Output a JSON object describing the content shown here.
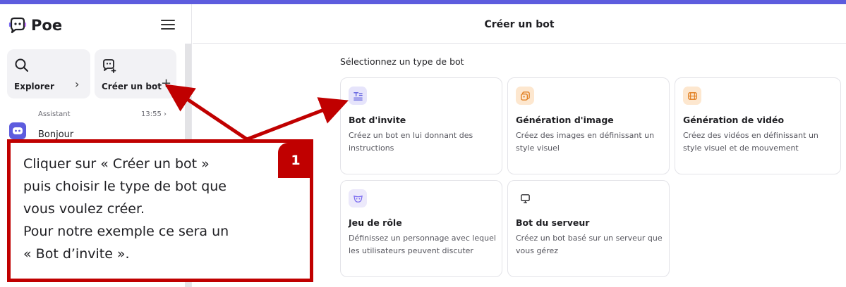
{
  "app": {
    "name": "Poe"
  },
  "sidebar": {
    "explore_label": "Explorer",
    "create_label": "Créer un bot",
    "chats": [
      {
        "name": "Assistant",
        "time": "13:55",
        "message": "Bonjour"
      }
    ]
  },
  "main": {
    "title": "Créer un bot",
    "section_label": "Sélectionnez un type de bot",
    "cards": [
      {
        "title": "Bot d'invite",
        "description": "Créez un bot en lui donnant des instructions",
        "icon": "prompt-icon"
      },
      {
        "title": "Génération d'image",
        "description": "Créez des images en définissant un style visuel",
        "icon": "image-icon"
      },
      {
        "title": "Génération de vidéo",
        "description": "Créez des vidéos en définissant un style visuel et de mouvement",
        "icon": "video-icon"
      },
      {
        "title": "Jeu de rôle",
        "description": "Définissez un personnage avec lequel les utilisateurs peuvent discuter",
        "icon": "mask-icon"
      },
      {
        "title": "Bot du serveur",
        "description": "Créez un bot basé sur un serveur que vous gérez",
        "icon": "monitor-icon"
      }
    ]
  },
  "annotation": {
    "badge": "1",
    "lines": [
      "Cliquer sur « Créer un bot »",
      "puis choisir le type de bot que",
      "vous voulez créer.",
      "Pour notre exemple ce sera un",
      "« Bot d’invite »."
    ]
  },
  "colors": {
    "accent": "#5d5cde",
    "annotation_red": "#c00000",
    "prompt_icon_bg": "#e6e4fb",
    "image_icon_bg": "#fde7cf",
    "video_icon_bg": "#fde7cf",
    "mask_icon_bg": "#ece9fb"
  }
}
